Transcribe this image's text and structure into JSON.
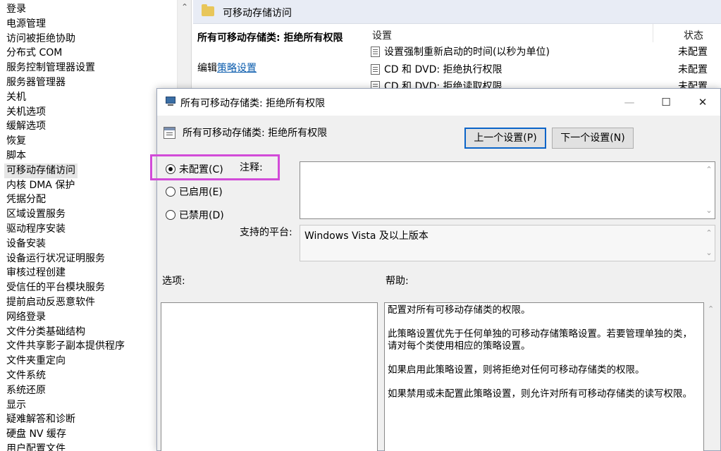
{
  "tree": {
    "items": [
      {
        "label": "登录"
      },
      {
        "label": "电源管理"
      },
      {
        "label": "访问被拒绝协助"
      },
      {
        "label": "分布式 COM"
      },
      {
        "label": "服务控制管理器设置"
      },
      {
        "label": "服务器管理器"
      },
      {
        "label": "关机"
      },
      {
        "label": "关机选项"
      },
      {
        "label": "缓解选项"
      },
      {
        "label": "恢复"
      },
      {
        "label": "脚本"
      },
      {
        "label": "可移动存储访问",
        "selected": true
      },
      {
        "label": "内核 DMA 保护"
      },
      {
        "label": "凭据分配"
      },
      {
        "label": "区域设置服务"
      },
      {
        "label": "驱动程序安装"
      },
      {
        "label": "设备安装"
      },
      {
        "label": "设备运行状况证明服务"
      },
      {
        "label": "审核过程创建"
      },
      {
        "label": "受信任的平台模块服务"
      },
      {
        "label": "提前启动反恶意软件"
      },
      {
        "label": "网络登录"
      },
      {
        "label": "文件分类基础结构"
      },
      {
        "label": "文件共享影子副本提供程序"
      },
      {
        "label": "文件夹重定向"
      },
      {
        "label": "文件系统"
      },
      {
        "label": "系统还原"
      },
      {
        "label": "显示"
      },
      {
        "label": "疑难解答和诊断"
      },
      {
        "label": "硬盘 NV 缓存"
      },
      {
        "label": "用户配置文件"
      }
    ]
  },
  "back_pane": {
    "header_title": "可移动存储访问",
    "policy_name": "所有可移动存储类: 拒绝所有权限",
    "edit_prefix": "编辑",
    "edit_link": "策略设置",
    "col_setting": "设置",
    "col_state": "状态",
    "rows": [
      {
        "setting": "设置强制重新启动的时间(以秒为单位)",
        "state": "未配置"
      },
      {
        "setting": "CD 和 DVD: 拒绝执行权限",
        "state": "未配置"
      },
      {
        "setting": "CD 和 DVD: 拒绝读取权限",
        "state": "未配置"
      }
    ]
  },
  "dialog": {
    "title": "所有可移动存储类: 拒绝所有权限",
    "subtitle": "所有可移动存储类: 拒绝所有权限",
    "prev_button": "上一个设置(P)",
    "next_button": "下一个设置(N)",
    "radio_not_configured": "未配置(C)",
    "radio_enabled": "已启用(E)",
    "radio_disabled": "已禁用(D)",
    "comment_label": "注释:",
    "platform_label": "支持的平台:",
    "platform_value": "Windows Vista 及以上版本",
    "options_label": "选项:",
    "help_label": "帮助:",
    "help_paragraphs": [
      "配置对所有可移动存储类的权限。",
      "此策略设置优先于任何单独的可移动存储策略设置。若要管理单独的类，请对每个类使用相应的策略设置。",
      "如果启用此策略设置，则将拒绝对任何可移动存储类的权限。",
      "如果禁用或未配置此策略设置，则允许对所有可移动存储类的读写权限。"
    ],
    "selected_radio": "not_configured"
  },
  "colors": {
    "highlight": "#d24bd8",
    "link": "#0b5cad",
    "focus": "#0a64c8"
  }
}
